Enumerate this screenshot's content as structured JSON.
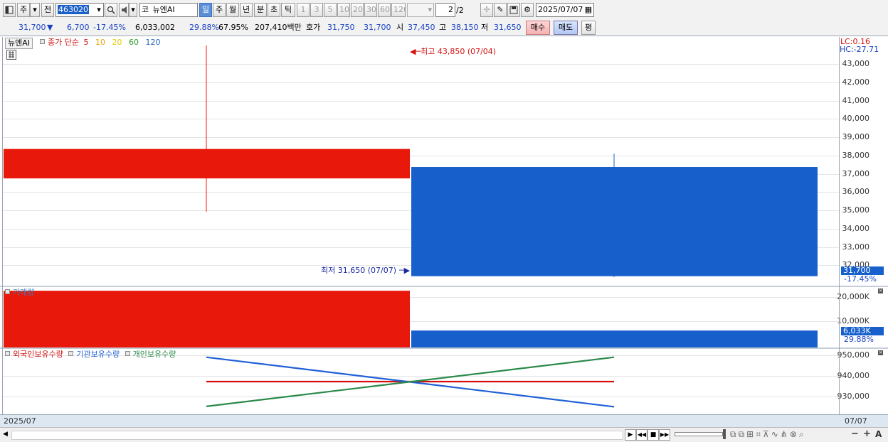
{
  "toolbar": {
    "period_btn": "주",
    "prev_btn": "전",
    "code": "463020",
    "code_prefix": "코",
    "stock_name": "뉴엔AI",
    "period_tabs": [
      "일",
      "주",
      "월",
      "년",
      "분",
      "초",
      "틱"
    ],
    "active_period": "일",
    "intervals": [
      "1",
      "3",
      "5",
      "10",
      "20",
      "30",
      "60",
      "120"
    ],
    "page_current": "2",
    "page_total": "/2",
    "date": "2025/07/07"
  },
  "quote": {
    "price": "31,700",
    "change_arrow": "▼",
    "change": "6,700",
    "change_pct": "-17.45%",
    "volume": "6,033,002",
    "turnover_pct": "29.88%",
    "ratio_pct": "67.95%",
    "amount": "207,410백만",
    "bid_ask_label": "호가",
    "ask": "31,750",
    "bid": "31,700",
    "open_label": "시",
    "open": "37,450",
    "high_label": "고",
    "high": "38,150",
    "low_label": "저",
    "low": "31,650",
    "buy_btn": "매수",
    "sell_btn": "매도",
    "eval_btn": "평"
  },
  "price_panel": {
    "name_tag": "뉴엔AI",
    "ma_label": "종가 단순",
    "ma_periods": [
      "5",
      "10",
      "20",
      "60",
      "120"
    ],
    "ma_colors": [
      "#d41010",
      "#e8a000",
      "#e0d000",
      "#2a9a2a",
      "#2066c0"
    ],
    "max_label": "최고 43,850 (07/04)",
    "min_label": "최저 31,650 (07/07)",
    "lc": "LC:0.16",
    "hc": "HC:-27.71",
    "y_ticks": [
      "43,000",
      "42,000",
      "41,000",
      "40,000",
      "39,000",
      "38,000",
      "37,000",
      "36,000",
      "35,000",
      "34,000",
      "33,000",
      "32,000"
    ],
    "last_price": "31,700",
    "last_pct": "-17.45%"
  },
  "volume_panel": {
    "label": "거래량",
    "y_ticks": [
      "20,000K",
      "10,000K"
    ],
    "last_value": "6,033K",
    "last_pct": "29.88%"
  },
  "holding_panel": {
    "series_labels": [
      "외국인보유수량",
      "기관보유수량",
      "개인보유수량"
    ],
    "series_colors": [
      "#d41010",
      "#2060d8",
      "#2a8a4a"
    ],
    "y_ticks": [
      "950,000",
      "940,000",
      "930,000"
    ]
  },
  "footer": {
    "date_left": "2025/07",
    "date_right": "07/07"
  },
  "chart_data": [
    {
      "type": "candlestick",
      "title": "뉴엔AI",
      "x": [
        "07/04",
        "07/07"
      ],
      "open": [
        36850,
        37450
      ],
      "high": [
        43850,
        38150
      ],
      "low": [
        35100,
        31650
      ],
      "close": [
        38400,
        31700
      ],
      "ylim": [
        31200,
        44300
      ],
      "colors": [
        "#e8190b",
        "#1760cc"
      ]
    },
    {
      "type": "bar",
      "title": "거래량",
      "categories": [
        "07/04",
        "07/07"
      ],
      "values": [
        20200,
        6033
      ],
      "unit": "K",
      "ylim": [
        0,
        21500
      ],
      "colors": [
        "#e8190b",
        "#1760cc"
      ]
    },
    {
      "type": "line",
      "categories": [
        "07/04",
        "07/07"
      ],
      "series": [
        {
          "name": "외국인보유수량",
          "values": [
            936500,
            936500
          ],
          "color": "#d41010"
        },
        {
          "name": "기관보유수량",
          "values": [
            948800,
            923800
          ],
          "color": "#2060d8"
        },
        {
          "name": "개인보유수량",
          "values": [
            924000,
            948800
          ],
          "color": "#2a8a4a"
        }
      ],
      "ylim": [
        920000,
        953000
      ]
    }
  ]
}
